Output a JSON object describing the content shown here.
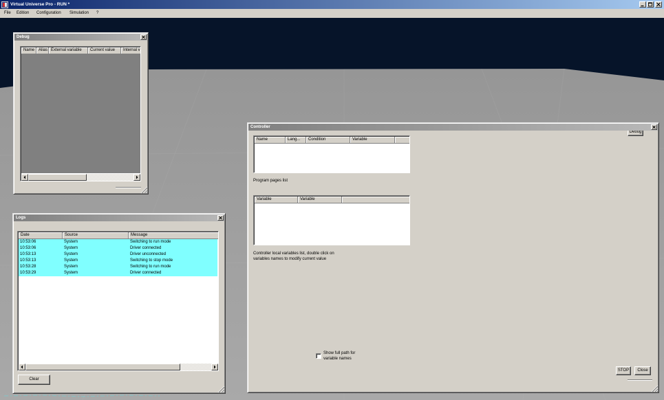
{
  "app": {
    "title": "Virtual Universe Pro - RUN *",
    "icon": "app-logo-icon"
  },
  "window_controls": {
    "minimize_icon": "minimize-icon",
    "maximize_icon": "maximize-icon",
    "close_icon": "close-icon"
  },
  "menu": [
    "File",
    "Edition",
    "Configuration",
    "Simulation",
    "?"
  ],
  "debug_panel": {
    "title": "Debug",
    "columns": [
      "Name",
      "Alias",
      "External variable",
      "Current value",
      "Internal v"
    ]
  },
  "logs_panel": {
    "title": "Logs",
    "columns": [
      "Date",
      "Source",
      "Message"
    ],
    "rows": [
      {
        "date": "10:53:06",
        "source": "System",
        "message": "Switching to run mode"
      },
      {
        "date": "10:53:06",
        "source": "System",
        "message": "Driver connected"
      },
      {
        "date": "10:53:13",
        "source": "System",
        "message": "Driver unconnected"
      },
      {
        "date": "10:53:13",
        "source": "System",
        "message": "Switching to stop mode"
      },
      {
        "date": "10:53:28",
        "source": "System",
        "message": "Switching to run mode"
      },
      {
        "date": "10:53:29",
        "source": "System",
        "message": "Driver connected"
      }
    ],
    "clear_label": "Clear"
  },
  "controller_panel": {
    "title": "Controller",
    "debug_label": "Debug",
    "pages_columns": [
      "Name",
      "Lang...",
      "Condition",
      "Variable"
    ],
    "pages_caption": "Program pages list",
    "variables_columns": [
      "Variable",
      "Variable"
    ],
    "variables_caption": [
      "Controller local variables list, double click on",
      "variables names to modify current value"
    ],
    "show_full_path": {
      "label": [
        "Show full path for",
        "variable names"
      ],
      "checked": false
    },
    "stop_label": "STOP",
    "close_label": "Close"
  },
  "colors": {
    "title_bar_start": "#0a246a",
    "title_bar_end": "#a6caf0",
    "panel_face": "#d4d0c8",
    "log_row_highlight": "#80ffff",
    "debug_list_bg": "#808080",
    "viewport_sky": "#061429",
    "viewport_floor": "#a9a9a9"
  }
}
